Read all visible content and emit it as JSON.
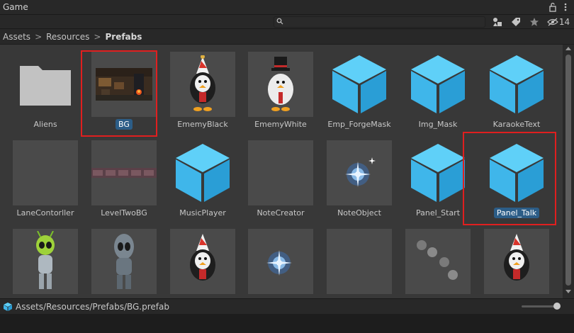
{
  "window": {
    "title": "Game"
  },
  "toolbar": {
    "search_value": "",
    "hidden_count": "14",
    "icons": [
      "search-icon",
      "filter-type-icon",
      "tag-icon",
      "star-icon",
      "eye-hidden-icon"
    ]
  },
  "breadcrumb": {
    "items": [
      "Assets",
      "Resources"
    ],
    "current": "Prefabs",
    "separator": ">"
  },
  "assets": [
    {
      "name": "Aliens",
      "kind": "folder"
    },
    {
      "name": "BG",
      "kind": "scene-image",
      "selected": true
    },
    {
      "name": "EmemyBlack",
      "kind": "penguin-black"
    },
    {
      "name": "EmemyWhite",
      "kind": "penguin-white"
    },
    {
      "name": "Emp_ForgeMask",
      "kind": "prefab-cube"
    },
    {
      "name": "Img_Mask",
      "kind": "prefab-cube"
    },
    {
      "name": "KaraokeText",
      "kind": "prefab-cube"
    },
    {
      "name": "LaneContorller",
      "kind": "empty"
    },
    {
      "name": "LevelTwoBG",
      "kind": "strip-image"
    },
    {
      "name": "MusicPlayer",
      "kind": "prefab-cube"
    },
    {
      "name": "NoteCreator",
      "kind": "empty"
    },
    {
      "name": "NoteObject",
      "kind": "sparkle"
    },
    {
      "name": "Panel_Start",
      "kind": "prefab-cube"
    },
    {
      "name": "Panel_Talk",
      "kind": "prefab-cube",
      "selected": true
    },
    {
      "name": "",
      "kind": "alien-green"
    },
    {
      "name": "",
      "kind": "alien-grey"
    },
    {
      "name": "",
      "kind": "penguin-black"
    },
    {
      "name": "",
      "kind": "sparkle"
    },
    {
      "name": "",
      "kind": "empty"
    },
    {
      "name": "",
      "kind": "balls"
    },
    {
      "name": "",
      "kind": "penguin-black"
    }
  ],
  "status": {
    "path": "Assets/Resources/Prefabs/BG.prefab",
    "icon": "prefab-cube-icon",
    "zoom": 0.9
  },
  "colors": {
    "accent": "#2c5d87",
    "cube": "#44c3f4",
    "highlight": "#e01f1f"
  }
}
